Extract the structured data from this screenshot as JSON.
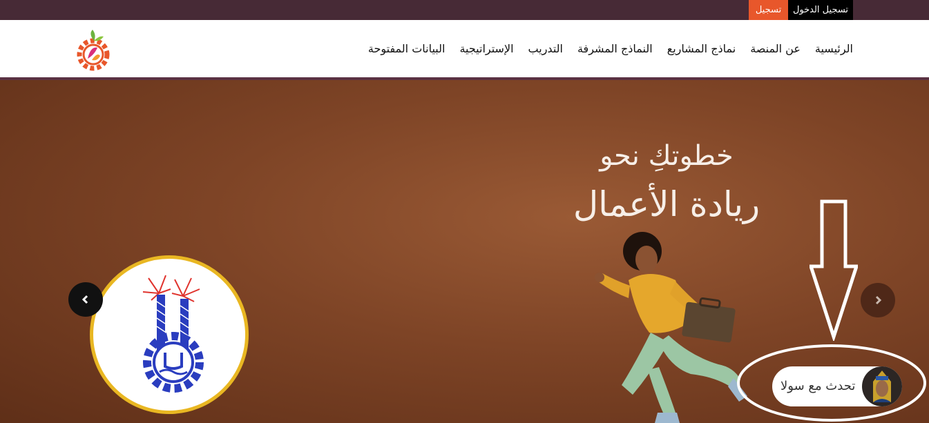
{
  "topbar": {
    "login_label": "تسجيل الدخول",
    "register_label": "تسجيل"
  },
  "nav": {
    "items": [
      "الرئيسية",
      "عن المنصة",
      "نماذج المشاريع",
      "النماذج المشرفة",
      "التدريب",
      "الإستراتيجية",
      "البيانات المفتوحة"
    ]
  },
  "hero": {
    "headline_line1": "خطوتكِ نحو",
    "headline_line2": "ريادة الأعمال"
  },
  "chat": {
    "label": "تحدث مع سولا"
  },
  "icons": {
    "logo": "gear-leaf-logo",
    "prev": "chevron-left-icon",
    "next": "chevron-right-icon",
    "annotation": "down-arrow-icon"
  },
  "colors": {
    "topbar": "#472a36",
    "register": "#e8572b",
    "login": "#000000",
    "emblem_border": "#e9b722"
  }
}
